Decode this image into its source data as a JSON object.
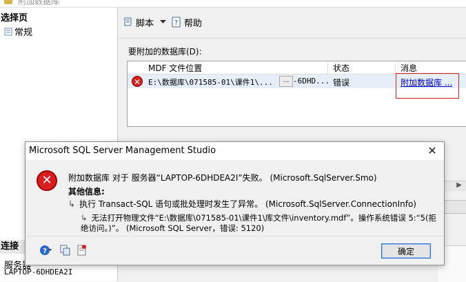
{
  "window": {
    "title": "附加数据库"
  },
  "left_pane": {
    "header": "选择页",
    "items": [
      {
        "label": "常规"
      }
    ],
    "connection_header": "连接",
    "server_label": "服务器",
    "server_value": "LAPTOP-6DHDEA2I"
  },
  "toolbar": {
    "script_label": "脚本",
    "help_label": "帮助"
  },
  "attach": {
    "label": "要附加的数据库(D):",
    "columns": [
      "MDF 文件位置",
      "状态",
      "消息"
    ],
    "rows": [
      {
        "path": "E:\\数据库\\071585-01\\课件1\\...",
        "browse": "...",
        "name": "-6DHD...",
        "status": "错误",
        "message": "附加数据库 ..."
      }
    ]
  },
  "dialog": {
    "title": "Microsoft SQL Server Management Studio",
    "close": "✕",
    "message1": "附加数据库 对于 服务器“LAPTOP-6DHDEA2I”失败。 (Microsoft.SqlServer.Smo)",
    "other_info": "其他信息:",
    "message2": "执行 Transact-SQL 语句或批处理时发生了异常。 (Microsoft.SqlServer.ConnectionInfo)",
    "message3": "无法打开物理文件“E:\\数据库\\071585-01\\课件1\\库文件\\inventory.mdf”。操作系统错误 5:“5(拒绝访问。)”。 (Microsoft SQL Server，错误: 5120)",
    "ok_label": "确定"
  },
  "colors": {
    "error_red": "#d81e1e",
    "link_blue": "#0000cc",
    "highlight_box": "#e02020",
    "button_focus": "#2a6fd6"
  }
}
